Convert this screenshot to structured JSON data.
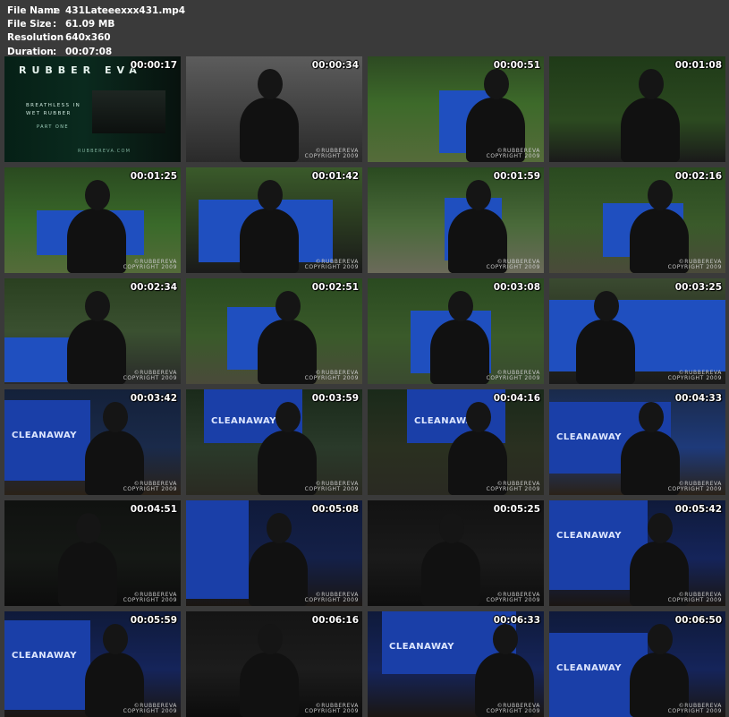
{
  "file_info": {
    "rows": [
      {
        "key": "File Name",
        "value": "431Lateeexxx431.mp4"
      },
      {
        "key": "File Size",
        "value": "61.09 MB"
      },
      {
        "key": "Resolution",
        "value": "640x360"
      },
      {
        "key": "Duration",
        "value": "00:07:08"
      }
    ],
    "separator": ":"
  },
  "intro_card": {
    "title": "RUBBER EVA",
    "subtitle": "BREATHLESS IN WET RUBBER",
    "part": "PART ONE",
    "site": "RUBBEREVA.COM"
  },
  "watermark": {
    "line1": "©RUBBEREVA",
    "line2": "COPYRIGHT 2009"
  },
  "bin_text": "CLEANAWAY",
  "thumbnails": [
    {
      "time": "00:00:17"
    },
    {
      "time": "00:00:34"
    },
    {
      "time": "00:00:51"
    },
    {
      "time": "00:01:08"
    },
    {
      "time": "00:01:25"
    },
    {
      "time": "00:01:42"
    },
    {
      "time": "00:01:59"
    },
    {
      "time": "00:02:16"
    },
    {
      "time": "00:02:34"
    },
    {
      "time": "00:02:51"
    },
    {
      "time": "00:03:08"
    },
    {
      "time": "00:03:25"
    },
    {
      "time": "00:03:42"
    },
    {
      "time": "00:03:59"
    },
    {
      "time": "00:04:16"
    },
    {
      "time": "00:04:33"
    },
    {
      "time": "00:04:51"
    },
    {
      "time": "00:05:08"
    },
    {
      "time": "00:05:25"
    },
    {
      "time": "00:05:42"
    },
    {
      "time": "00:05:59"
    },
    {
      "time": "00:06:16"
    },
    {
      "time": "00:06:33"
    },
    {
      "time": "00:06:50"
    }
  ]
}
